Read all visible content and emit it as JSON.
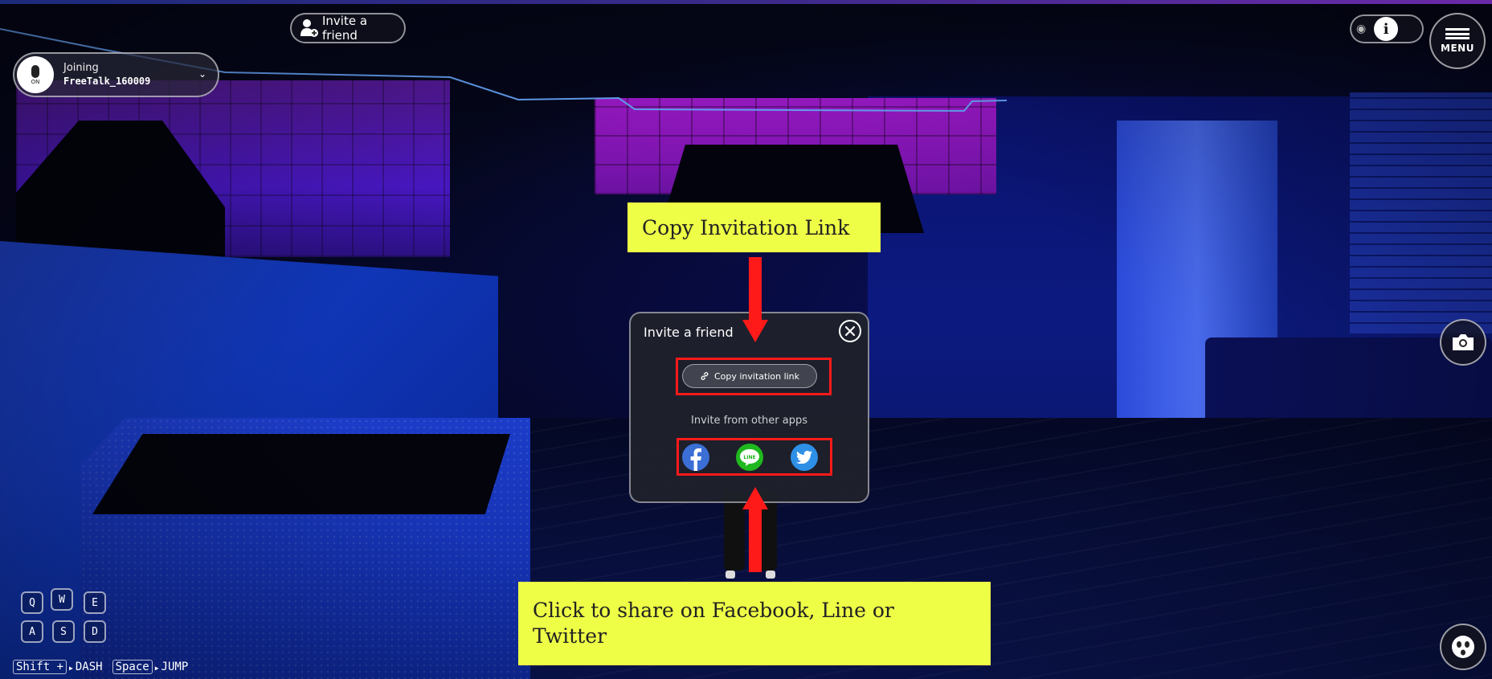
{
  "hud": {
    "invite_button_label": "Invite a friend",
    "voice_status_label": "Joining",
    "room_name": "FreeTalk_160009",
    "mic_state": "ON",
    "menu_label": "MENU"
  },
  "controls": {
    "keys": [
      "Q",
      "W",
      "E",
      "A",
      "S",
      "D"
    ],
    "dash_key": "Shift +",
    "dash_label": "DASH",
    "jump_key": "Space",
    "jump_label": "JUMP"
  },
  "modal": {
    "title": "Invite a friend",
    "copy_button_label": "Copy invitation link",
    "other_apps_label": "Invite from other apps",
    "line_icon_text": "LINE",
    "share_targets": [
      "facebook-icon",
      "line-icon",
      "twitter-icon"
    ]
  },
  "annotations": {
    "copy_callout": "Copy Invitation Link",
    "share_callout": "Click to share on Facebook, Line or\nTwitter",
    "callout_color": "#eefd46",
    "highlight_color": "#ff1a1a"
  },
  "colors": {
    "facebook": "#3b6fd6",
    "line": "#1fb81f",
    "twitter": "#2e8fe6"
  }
}
